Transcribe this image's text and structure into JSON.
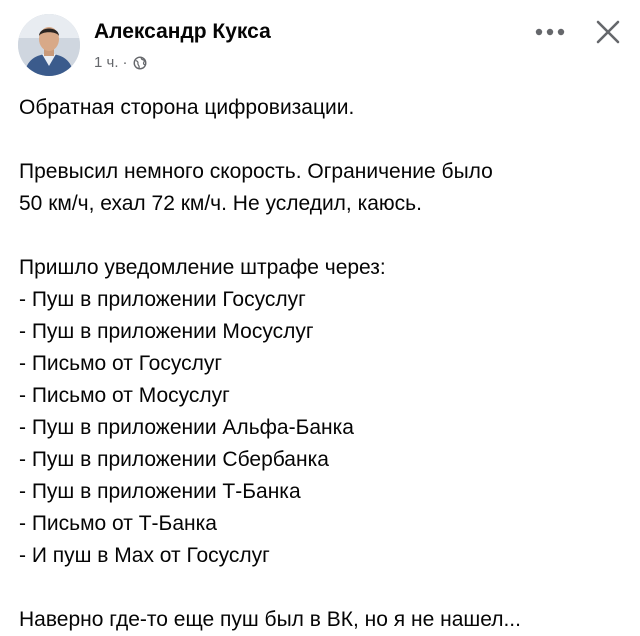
{
  "post": {
    "author": "Александр Кукса",
    "time": "1 ч.",
    "separator": "·",
    "privacy_icon": "globe-icon",
    "more_icon": "more-options-icon",
    "close_icon": "close-icon",
    "paragraphs": [
      [
        "Обратная сторона цифровизации."
      ],
      [
        "Превысил немного скорость. Ограничение было",
        "50 км/ч, ехал 72 км/ч. Не уследил, каюсь."
      ],
      [
        "Пришло уведомление штрафе через:",
        "- Пуш в приложении Госуслуг",
        "- Пуш в приложении Мосуслуг",
        "- Письмо от Госуслуг",
        "- Письмо от Мосуслуг",
        "- Пуш в приложении Альфа-Банка",
        "- Пуш в приложении Сбербанка",
        "- Пуш в приложении Т-Банка",
        "- Письмо от Т-Банка",
        "- И пуш в Max от Госуслуг"
      ],
      [
        "Наверно где-то еще пуш был в ВК, но я не нашел..."
      ]
    ]
  },
  "colors": {
    "text": "#050505",
    "secondary": "#65676b",
    "background": "#ffffff"
  }
}
